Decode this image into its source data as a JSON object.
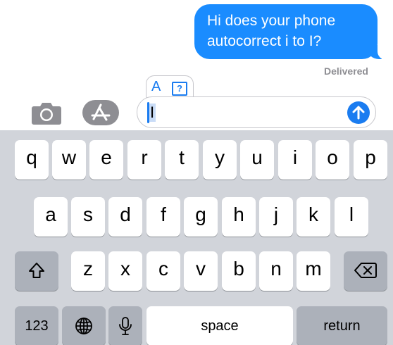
{
  "conversation": {
    "message_line1": "Hi does your phone",
    "message_line2": "autocorrect i to I?",
    "status": "Delivered"
  },
  "suggestion": {
    "letter": "A",
    "unknown": "?"
  },
  "composer": {
    "text": "I"
  },
  "keyboard": {
    "row1": [
      "q",
      "w",
      "e",
      "r",
      "t",
      "y",
      "u",
      "i",
      "o",
      "p"
    ],
    "row2": [
      "a",
      "s",
      "d",
      "f",
      "g",
      "h",
      "j",
      "k",
      "l"
    ],
    "row3": [
      "z",
      "x",
      "c",
      "v",
      "b",
      "n",
      "m"
    ],
    "numbers_label": "123",
    "space_label": "space",
    "return_label": "return"
  },
  "colors": {
    "accent": "#1a7cf0",
    "bubble": "#1a8cff",
    "keyboard_bg": "#d1d4da",
    "modifier_key": "#acb1ba"
  }
}
